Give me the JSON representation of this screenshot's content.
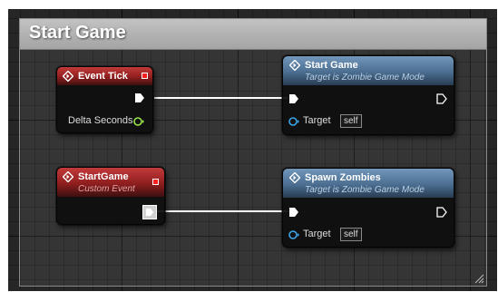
{
  "comment": {
    "title": "Start Game"
  },
  "nodes": {
    "event_tick": {
      "title": "Event Tick",
      "outputs": {
        "delta": "Delta Seconds"
      }
    },
    "start_game_event": {
      "title": "StartGame",
      "subtitle": "Custom Event"
    },
    "start_game_call": {
      "title": "Start Game",
      "subtitle": "Target is Zombie Game Mode",
      "target_label": "Target",
      "target_value": "self"
    },
    "spawn_zombies_call": {
      "title": "Spawn Zombies",
      "subtitle": "Target is Zombie Game Mode",
      "target_label": "Target",
      "target_value": "self"
    }
  },
  "colors": {
    "event_header": "#8f1e1e",
    "function_header": "#4b6e91",
    "float_pin": "#9ae64a",
    "object_pin": "#3aa6e8",
    "exec_wire": "#ffffff"
  },
  "icons": [
    "function-icon",
    "event-icon",
    "exec-pin-icon",
    "float-pin-icon",
    "object-pin-icon",
    "resize-grip-icon"
  ]
}
